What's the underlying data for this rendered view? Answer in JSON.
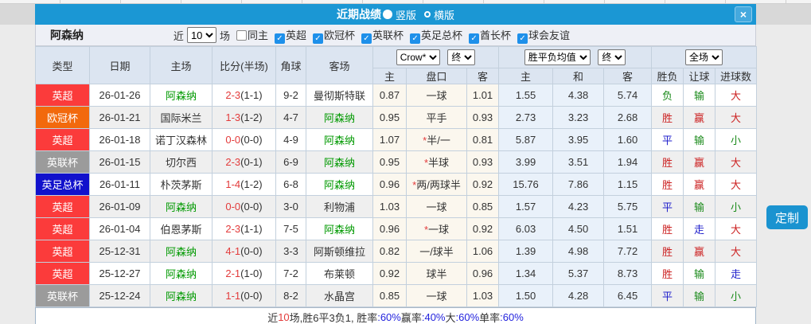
{
  "titlebar": {
    "title": "近期战绩",
    "radio_vertical": "竖版",
    "radio_horizontal": "横版",
    "close": "×"
  },
  "filterbar": {
    "team": "阿森纳",
    "near_label": "近",
    "matches_count": "10",
    "matches_label": "场",
    "checkboxes": [
      {
        "label": "同主",
        "checked": false
      },
      {
        "label": "英超",
        "checked": true
      },
      {
        "label": "欧冠杯",
        "checked": true
      },
      {
        "label": "英联杯",
        "checked": true
      },
      {
        "label": "英足总杯",
        "checked": true
      },
      {
        "label": "酋长杯",
        "checked": true
      },
      {
        "label": "球会友谊",
        "checked": true
      }
    ]
  },
  "table": {
    "main_headers": [
      "类型",
      "日期",
      "主场",
      "比分(半场)",
      "角球",
      "客场"
    ],
    "selects": {
      "odds_source": "Crow*",
      "odds_state": "终",
      "avg_source": "胜平负均值",
      "avg_state": "终",
      "scope": "全场"
    },
    "sub_headers": [
      "主",
      "盘口",
      "客",
      "主",
      "和",
      "客",
      "胜负",
      "让球",
      "进球数"
    ],
    "rows": [
      {
        "league": "英超",
        "league_color": "#fb3b3b",
        "date": "26-01-26",
        "home": "阿森纳",
        "home_is_team": true,
        "score": "2-3",
        "half": "(1-1)",
        "corners": "9-2",
        "away": "曼彻斯特联",
        "away_is_team": false,
        "odds_home": "0.87",
        "handicap": "一球",
        "handicap_star": false,
        "odds_away": "1.01",
        "avg_win": "1.55",
        "avg_draw": "4.38",
        "avg_lose": "5.74",
        "result": "负",
        "result_color": "green",
        "handicap_result": "输",
        "handicap_result_color": "green",
        "goals": "大",
        "goals_color": "red"
      },
      {
        "league": "欧冠杯",
        "league_color": "#f2690d",
        "date": "26-01-21",
        "home": "国际米兰",
        "home_is_team": false,
        "score": "1-3",
        "half": "(1-2)",
        "corners": "4-7",
        "away": "阿森纳",
        "away_is_team": true,
        "odds_home": "0.95",
        "handicap": "平手",
        "handicap_star": false,
        "odds_away": "0.93",
        "avg_win": "2.73",
        "avg_draw": "3.23",
        "avg_lose": "2.68",
        "result": "胜",
        "result_color": "red",
        "handicap_result": "赢",
        "handicap_result_color": "red",
        "goals": "大",
        "goals_color": "red"
      },
      {
        "league": "英超",
        "league_color": "#fb3b3b",
        "date": "26-01-18",
        "home": "诺丁汉森林",
        "home_is_team": false,
        "score": "0-0",
        "half": "(0-0)",
        "corners": "4-9",
        "away": "阿森纳",
        "away_is_team": true,
        "odds_home": "1.07",
        "handicap": "半/一",
        "handicap_star": true,
        "odds_away": "0.81",
        "avg_win": "5.87",
        "avg_draw": "3.95",
        "avg_lose": "1.60",
        "result": "平",
        "result_color": "blue",
        "handicap_result": "输",
        "handicap_result_color": "green",
        "goals": "小",
        "goals_color": "green"
      },
      {
        "league": "英联杯",
        "league_color": "#9b9b9b",
        "date": "26-01-15",
        "home": "切尔西",
        "home_is_team": false,
        "score": "2-3",
        "half": "(0-1)",
        "corners": "6-9",
        "away": "阿森纳",
        "away_is_team": true,
        "odds_home": "0.95",
        "handicap": "半球",
        "handicap_star": true,
        "odds_away": "0.93",
        "avg_win": "3.99",
        "avg_draw": "3.51",
        "avg_lose": "1.94",
        "result": "胜",
        "result_color": "red",
        "handicap_result": "赢",
        "handicap_result_color": "red",
        "goals": "大",
        "goals_color": "red"
      },
      {
        "league": "英足总杯",
        "league_color": "#1111cc",
        "date": "26-01-11",
        "home": "朴茨茅斯",
        "home_is_team": false,
        "score": "1-4",
        "half": "(1-2)",
        "corners": "6-8",
        "away": "阿森纳",
        "away_is_team": true,
        "odds_home": "0.96",
        "handicap": "两/两球半",
        "handicap_star": true,
        "odds_away": "0.92",
        "avg_win": "15.76",
        "avg_draw": "7.86",
        "avg_lose": "1.15",
        "result": "胜",
        "result_color": "red",
        "handicap_result": "赢",
        "handicap_result_color": "red",
        "goals": "大",
        "goals_color": "red"
      },
      {
        "league": "英超",
        "league_color": "#fb3b3b",
        "date": "26-01-09",
        "home": "阿森纳",
        "home_is_team": true,
        "score": "0-0",
        "half": "(0-0)",
        "corners": "3-0",
        "away": "利物浦",
        "away_is_team": false,
        "odds_home": "1.03",
        "handicap": "一球",
        "handicap_star": false,
        "odds_away": "0.85",
        "avg_win": "1.57",
        "avg_draw": "4.23",
        "avg_lose": "5.75",
        "result": "平",
        "result_color": "blue",
        "handicap_result": "输",
        "handicap_result_color": "green",
        "goals": "小",
        "goals_color": "green"
      },
      {
        "league": "英超",
        "league_color": "#fb3b3b",
        "date": "26-01-04",
        "home": "伯恩茅斯",
        "home_is_team": false,
        "score": "2-3",
        "half": "(1-1)",
        "corners": "7-5",
        "away": "阿森纳",
        "away_is_team": true,
        "odds_home": "0.96",
        "handicap": "一球",
        "handicap_star": true,
        "odds_away": "0.92",
        "avg_win": "6.03",
        "avg_draw": "4.50",
        "avg_lose": "1.51",
        "result": "胜",
        "result_color": "red",
        "handicap_result": "走",
        "handicap_result_color": "blue",
        "goals": "大",
        "goals_color": "red"
      },
      {
        "league": "英超",
        "league_color": "#fb3b3b",
        "date": "25-12-31",
        "home": "阿森纳",
        "home_is_team": true,
        "score": "4-1",
        "half": "(0-0)",
        "corners": "3-3",
        "away": "阿斯顿维拉",
        "away_is_team": false,
        "odds_home": "0.82",
        "handicap": "一/球半",
        "handicap_star": false,
        "odds_away": "1.06",
        "avg_win": "1.39",
        "avg_draw": "4.98",
        "avg_lose": "7.72",
        "result": "胜",
        "result_color": "red",
        "handicap_result": "赢",
        "handicap_result_color": "red",
        "goals": "大",
        "goals_color": "red"
      },
      {
        "league": "英超",
        "league_color": "#fb3b3b",
        "date": "25-12-27",
        "home": "阿森纳",
        "home_is_team": true,
        "score": "2-1",
        "half": "(1-0)",
        "corners": "7-2",
        "away": "布莱顿",
        "away_is_team": false,
        "odds_home": "0.92",
        "handicap": "球半",
        "handicap_star": false,
        "odds_away": "0.96",
        "avg_win": "1.34",
        "avg_draw": "5.37",
        "avg_lose": "8.73",
        "result": "胜",
        "result_color": "red",
        "handicap_result": "输",
        "handicap_result_color": "green",
        "goals": "走",
        "goals_color": "blue"
      },
      {
        "league": "英联杯",
        "league_color": "#9b9b9b",
        "date": "25-12-24",
        "home": "阿森纳",
        "home_is_team": true,
        "score": "1-1",
        "half": "(0-0)",
        "corners": "8-2",
        "away": "水晶宫",
        "away_is_team": false,
        "odds_home": "0.85",
        "handicap": "一球",
        "handicap_star": false,
        "odds_away": "1.03",
        "avg_win": "1.50",
        "avg_draw": "4.28",
        "avg_lose": "6.45",
        "result": "平",
        "result_color": "blue",
        "handicap_result": "输",
        "handicap_result_color": "green",
        "goals": "小",
        "goals_color": "green"
      }
    ]
  },
  "footer": {
    "segments": [
      {
        "text": "近",
        "color": "dark"
      },
      {
        "text": "10",
        "color": "red"
      },
      {
        "text": "场,胜6平3负1, 胜率",
        "color": "dark"
      },
      {
        "text": ":60%",
        "color": "blue"
      },
      {
        "text": " 赢率",
        "color": "dark"
      },
      {
        "text": ":40%",
        "color": "blue"
      },
      {
        "text": " 大",
        "color": "dark"
      },
      {
        "text": ":60%",
        "color": "blue"
      },
      {
        "text": " 单率",
        "color": "dark"
      },
      {
        "text": ":60%",
        "color": "blue"
      }
    ]
  },
  "custom_button": "定制",
  "colors": {
    "titlebar_blue": "#1b97d4",
    "checkbox_blue": "#1e90ea",
    "premier_league_red": "#fb3b3b",
    "champions_league_orange": "#f2690d",
    "league_cup_gray": "#9b9b9b",
    "fa_cup_blue": "#1111cc",
    "win_red": "#cc2222",
    "draw_blue": "#2222cc",
    "lose_green": "#1a8a1a",
    "team_green": "#009900"
  }
}
